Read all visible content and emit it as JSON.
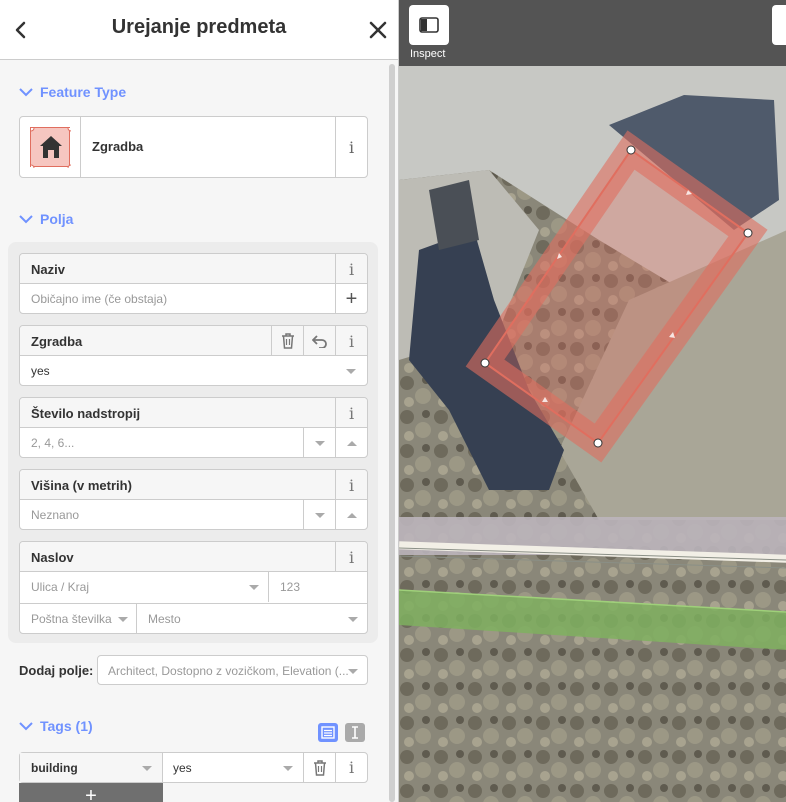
{
  "header": {
    "title": "Urejanje predmeta",
    "back_icon": "chevron-left-icon",
    "close_icon": "close-icon"
  },
  "feature_type_section": {
    "title": "Feature Type",
    "preset_label": "Zgradba",
    "preset_icon": "house-icon",
    "info": "i"
  },
  "fields_section": {
    "title": "Polja",
    "fields": {
      "name": {
        "label": "Naziv",
        "placeholder": "Običajno ime (če obstaja)",
        "info": "i",
        "add": "+"
      },
      "building": {
        "label": "Zgradba",
        "value": "yes",
        "info": "i"
      },
      "levels": {
        "label": "Število nadstropij",
        "placeholder": "2, 4, 6...",
        "info": "i"
      },
      "height": {
        "label": "Višina (v metrih)",
        "placeholder": "Neznano",
        "info": "i"
      },
      "address": {
        "label": "Naslov",
        "info": "i",
        "street_placeholder": "Ulica / Kraj",
        "housenumber_placeholder": "123",
        "postcode_placeholder": "Poštna številka",
        "city_placeholder": "Mesto"
      }
    }
  },
  "add_field": {
    "label": "Dodaj polje:",
    "placeholder": "Architect, Dostopno z vozičkom, Elevation (..."
  },
  "tags_section": {
    "title": "Tags (1)",
    "rows": [
      {
        "key": "building",
        "value": "yes"
      }
    ],
    "info": "i",
    "add": "+"
  },
  "map": {
    "inspect_label": "Inspect",
    "colors": {
      "building_fill": "#e06e5f",
      "building_stroke": "#e06e5f",
      "accent": "#7092ff"
    }
  }
}
